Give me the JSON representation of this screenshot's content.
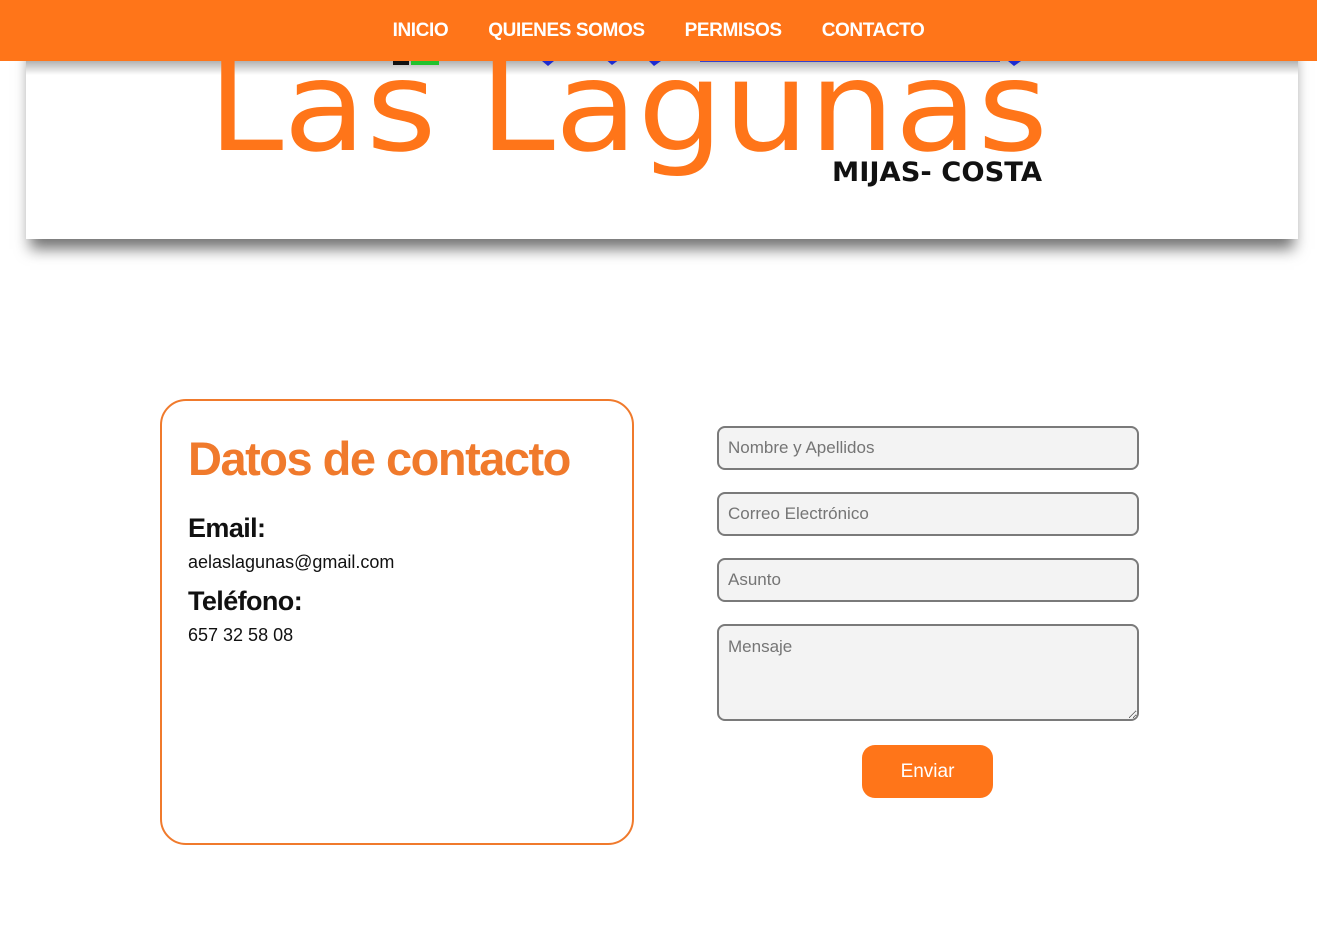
{
  "nav": {
    "items": [
      {
        "label": "INICIO"
      },
      {
        "label": "QUIENES SOMOS"
      },
      {
        "label": "PERMISOS"
      },
      {
        "label": "CONTACTO"
      }
    ]
  },
  "logo": {
    "title": "Las Lagunas",
    "subtitle": "MIJAS- COSTA",
    "colors": {
      "primary": "#ff7519",
      "subtitle": "#111111"
    }
  },
  "contact": {
    "title": "Datos de contacto",
    "email_label": "Email:",
    "email_value": "aelaslagunas@gmail.com",
    "phone_label": "Teléfono:",
    "phone_value": "657 32 58 08"
  },
  "form": {
    "name_placeholder": "Nombre y Apellidos",
    "email_placeholder": "Correo Electrónico",
    "subject_placeholder": "Asunto",
    "message_placeholder": "Mensaje",
    "submit_label": "Enviar"
  },
  "colors": {
    "accent": "#ff7519",
    "card_border": "#f07a2c",
    "input_bg": "#f3f3f3",
    "input_border": "#7a7a7a"
  }
}
